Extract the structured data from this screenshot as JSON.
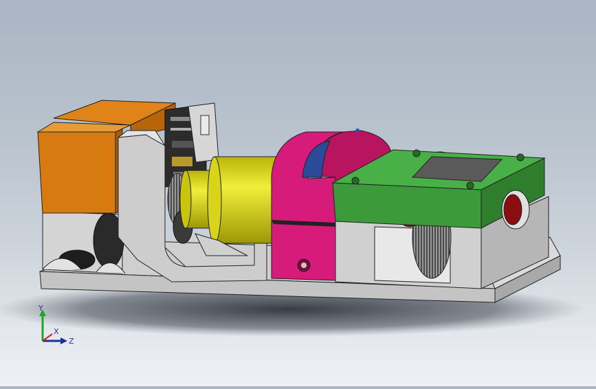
{
  "viewport": {
    "background_top": "#a9b5c3",
    "background_bottom": "#eef1f4"
  },
  "model": {
    "base_color": "#c8c8c8",
    "orange_block_color": "#d9780f",
    "yellow_motor_color": "#e0dc12",
    "magenta_clamp_color": "#d41a78",
    "green_block_color": "#3a9a3a",
    "red_hole_color": "#8a0d12",
    "blue_bearing_color": "#2b4a9a"
  },
  "triad": {
    "y_label": "Y",
    "x_label": "X",
    "z_label": "Z",
    "y_color": "#1aa82a",
    "x_color": "#c8281e",
    "z_color": "#1c2f9a"
  }
}
